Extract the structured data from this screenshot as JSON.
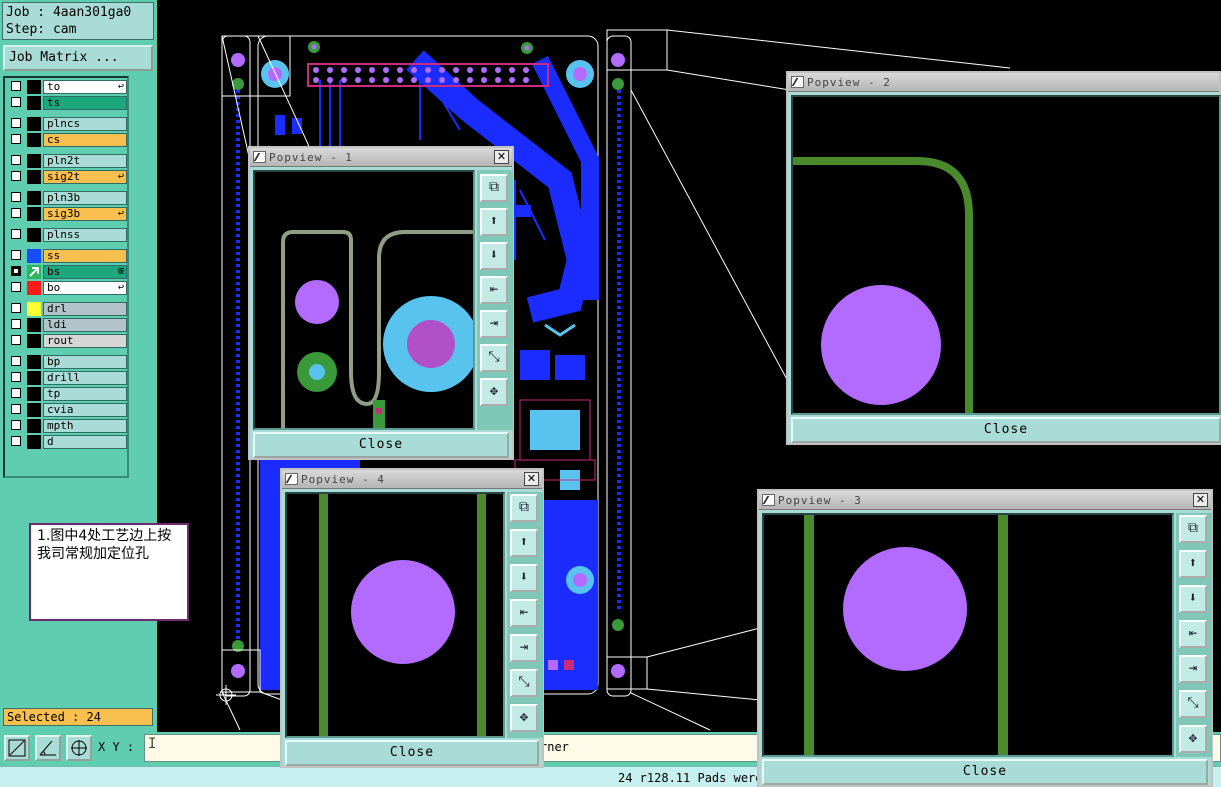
{
  "job": {
    "job_line": "Job : 4aan301ga0",
    "step_line": "Step: cam"
  },
  "matrix_button": "Job Matrix ...",
  "layers": [
    {
      "name": "to",
      "style": "white",
      "swatch": "#000000",
      "checked": false,
      "mark": "↩"
    },
    {
      "name": "ts",
      "style": "green",
      "swatch": "#000000",
      "checked": false,
      "mark": ""
    },
    {
      "name": "plncs",
      "style": "normal",
      "swatch": "#000000",
      "checked": false,
      "mark": ""
    },
    {
      "name": "cs",
      "style": "orange",
      "swatch": "#000000",
      "checked": false,
      "mark": ""
    },
    {
      "name": "pln2t",
      "style": "normal",
      "swatch": "#000000",
      "checked": false,
      "mark": ""
    },
    {
      "name": "sig2t",
      "style": "orange",
      "swatch": "#000000",
      "checked": false,
      "mark": "↩"
    },
    {
      "name": "pln3b",
      "style": "normal",
      "swatch": "#000000",
      "checked": false,
      "mark": ""
    },
    {
      "name": "sig3b",
      "style": "orange",
      "swatch": "#000000",
      "checked": false,
      "mark": "↩"
    },
    {
      "name": "plnss",
      "style": "normal",
      "swatch": "#000000",
      "checked": false,
      "mark": ""
    },
    {
      "name": "ss",
      "style": "orange",
      "swatch": "#1a4cff",
      "checked": false,
      "mark": ""
    },
    {
      "name": "bs",
      "style": "green",
      "swatch": "#2bb55a",
      "checked": true,
      "mark": "⊞"
    },
    {
      "name": "bo",
      "style": "white",
      "swatch": "#ff1a1a",
      "checked": false,
      "mark": "↩"
    },
    {
      "name": "drl",
      "style": "grey",
      "swatch": "#ffff33",
      "checked": false,
      "mark": ""
    },
    {
      "name": "ldi",
      "style": "grey",
      "swatch": "#000000",
      "checked": false,
      "mark": ""
    },
    {
      "name": "rout",
      "style": "lgrey",
      "swatch": "#000000",
      "checked": false,
      "mark": ""
    },
    {
      "name": "bp",
      "style": "normal",
      "swatch": "#000000",
      "checked": false,
      "mark": ""
    },
    {
      "name": "drill",
      "style": "normal",
      "swatch": "#000000",
      "checked": false,
      "mark": ""
    },
    {
      "name": "tp",
      "style": "normal",
      "swatch": "#000000",
      "checked": false,
      "mark": ""
    },
    {
      "name": "cvia",
      "style": "normal",
      "swatch": "#000000",
      "checked": false,
      "mark": ""
    },
    {
      "name": "mpth",
      "style": "normal",
      "swatch": "#000000",
      "checked": false,
      "mark": ""
    },
    {
      "name": "d",
      "style": "normal",
      "swatch": "#000000",
      "checked": false,
      "mark": ""
    }
  ],
  "selected": "Selected : 24",
  "bottom": {
    "xy_label": "X Y :",
    "xy_value": "",
    "partial_text": "rner"
  },
  "status": "24 r128.11 Pads were",
  "note": "1.图中4处工艺边上按我司常规加定位孔",
  "popups": [
    {
      "title": "Popview - 1",
      "close": "Close"
    },
    {
      "title": "Popview - 2",
      "close": "Close"
    },
    {
      "title": "Popview - 3",
      "close": "Close"
    },
    {
      "title": "Popview - 4",
      "close": "Close"
    }
  ],
  "colors": {
    "panel": "#5fcdb0",
    "trace": "#1a2cff",
    "green_trace": "#4a8a2c",
    "pad_violet": "#b36bff",
    "pad_cyan": "#59c3f0"
  },
  "icons": [
    "zoom-fit-icon",
    "pan-up-icon",
    "pan-down-icon",
    "pan-left-icon",
    "pan-right-icon",
    "zoom-out-icon",
    "zoom-in-icon"
  ]
}
